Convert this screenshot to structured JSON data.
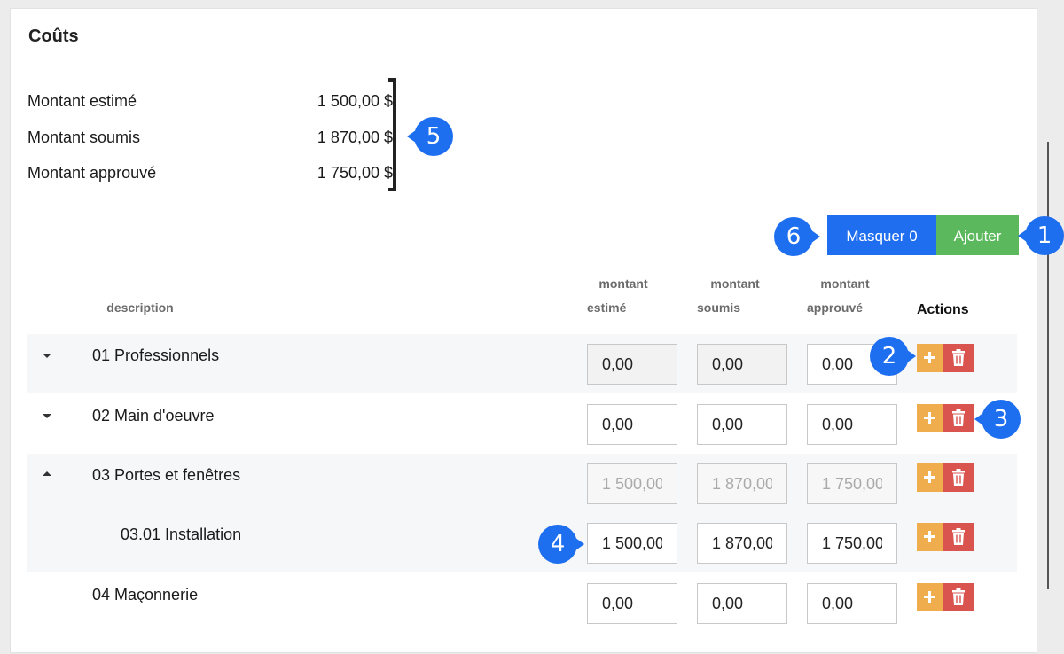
{
  "panel": {
    "title": "Coûts"
  },
  "summary": [
    {
      "label": "Montant estimé",
      "value": "1 500,00 $"
    },
    {
      "label": "Montant soumis",
      "value": "1 870,00 $"
    },
    {
      "label": "Montant approuvé",
      "value": "1 750,00 $"
    }
  ],
  "callouts": [
    "1",
    "2",
    "3",
    "4",
    "5",
    "6"
  ],
  "toolbar": {
    "hide_label": "Masquer 0",
    "add_label": "Ajouter"
  },
  "colors": {
    "primary": "#1f6ef0",
    "success": "#5cb85c",
    "warning": "#f0ad4e",
    "danger": "#d9534f",
    "callout": "#1e6ff0"
  },
  "table": {
    "headers": {
      "description": "description",
      "estimated_1": "montant",
      "estimated_2": "estimé",
      "submitted_1": "montant",
      "submitted_2": "soumis",
      "approved_1": "montant",
      "approved_2": "approuvé",
      "actions": "Actions"
    },
    "rows": [
      {
        "label": "01 Professionnels",
        "caret": "down",
        "estimated": "0,00",
        "submitted": "0,00",
        "approved": "0,00"
      },
      {
        "label": "02 Main d'oeuvre",
        "caret": "down",
        "estimated": "0,00",
        "submitted": "0,00",
        "approved": "0,00"
      },
      {
        "label": "03 Portes et fenêtres",
        "caret": "up",
        "estimated": "1 500,00",
        "submitted": "1 870,00",
        "approved": "1 750,00"
      },
      {
        "label": "03.01 Installation",
        "caret": "none",
        "estimated": "1 500,00",
        "submitted": "1 870,00",
        "approved": "1 750,00"
      },
      {
        "label": "04 Maçonnerie",
        "caret": "none",
        "estimated": "0,00",
        "submitted": "0,00",
        "approved": "0,00"
      }
    ]
  },
  "icons": {
    "add": "plus-icon",
    "delete": "trash-icon",
    "expand": "caret-down-icon",
    "collapse": "caret-up-icon"
  }
}
